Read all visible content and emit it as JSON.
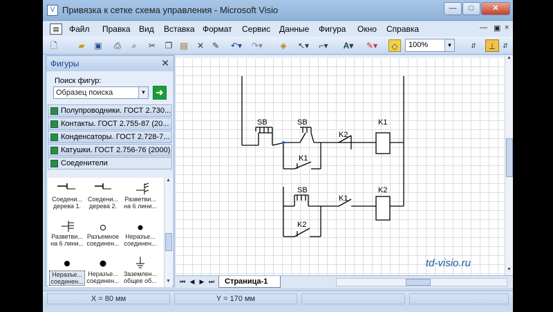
{
  "window": {
    "title": "Привязка к сетке схема управления - Microsoft Visio",
    "app_icon": "visio-icon",
    "controls": [
      "—",
      "□",
      "✕"
    ]
  },
  "menu": {
    "items": [
      "Файл",
      "Правка",
      "Вид",
      "Вставка",
      "Формат",
      "Сервис",
      "Данные",
      "Фигура",
      "Окно",
      "Справка"
    ],
    "doc_controls": [
      "—",
      "×"
    ]
  },
  "toolbar": {
    "zoom": "100%",
    "icons": [
      "new-icon",
      "open-icon",
      "save-icon",
      "print-icon",
      "print-preview-icon",
      "cut-icon",
      "copy-icon",
      "paste-icon",
      "delete-icon",
      "format-painter-icon",
      "undo-icon",
      "redo-icon",
      "shapes-icon",
      "pointer-icon",
      "connector-icon",
      "text-icon",
      "line-color-icon",
      "fill-icon"
    ]
  },
  "panel": {
    "title": "Фигуры",
    "search_label": "Поиск фигур:",
    "search_value": "Образец поиска",
    "stencils": [
      "Полупроводники. ГОСТ 2.730...",
      "Контакты. ГОСТ 2.755-87 (20...",
      "Конденсаторы. ГОСТ 2.728-7...",
      "Катушки. ГОСТ 2.756-76 (2000)",
      "Соеденители"
    ],
    "shapes": [
      {
        "label": "Соедени...\nдерева 1.",
        "icon": "connector-tree-icon"
      },
      {
        "label": "Соедени...\nдерева 2.",
        "icon": "connector-tree-icon"
      },
      {
        "label": "Разветви...\nна 6 лини...",
        "icon": "branch-icon"
      },
      {
        "label": "Разветви...\nна 6 лини...",
        "icon": "branch-icon"
      },
      {
        "label": "Разъемное\nсоединен...",
        "icon": "open-circle-icon"
      },
      {
        "label": "Неразъе...\nсоединен...",
        "icon": "filled-dot-icon"
      },
      {
        "label": "Неразъе...\nсоединен...",
        "icon": "filled-dot-icon"
      },
      {
        "label": "Неразъе...\nсоединен...",
        "icon": "filled-dot-icon"
      },
      {
        "label": "Заземлен...\nобщее об...",
        "icon": "ground-icon"
      }
    ]
  },
  "diagram": {
    "labels": {
      "sb1": "SB",
      "sb2": "SB",
      "k1_coil": "K1",
      "k2_contact": "K2",
      "k1_contact": "K1",
      "sb3": "SB",
      "k2_coil": "K2",
      "k1_contact2": "K1",
      "k2_contact2": "K2"
    }
  },
  "page_tab": "Страница-1",
  "status": {
    "x": "X = 80 мм",
    "y": "Y = 170 мм"
  },
  "watermark": "td-visio.ru"
}
